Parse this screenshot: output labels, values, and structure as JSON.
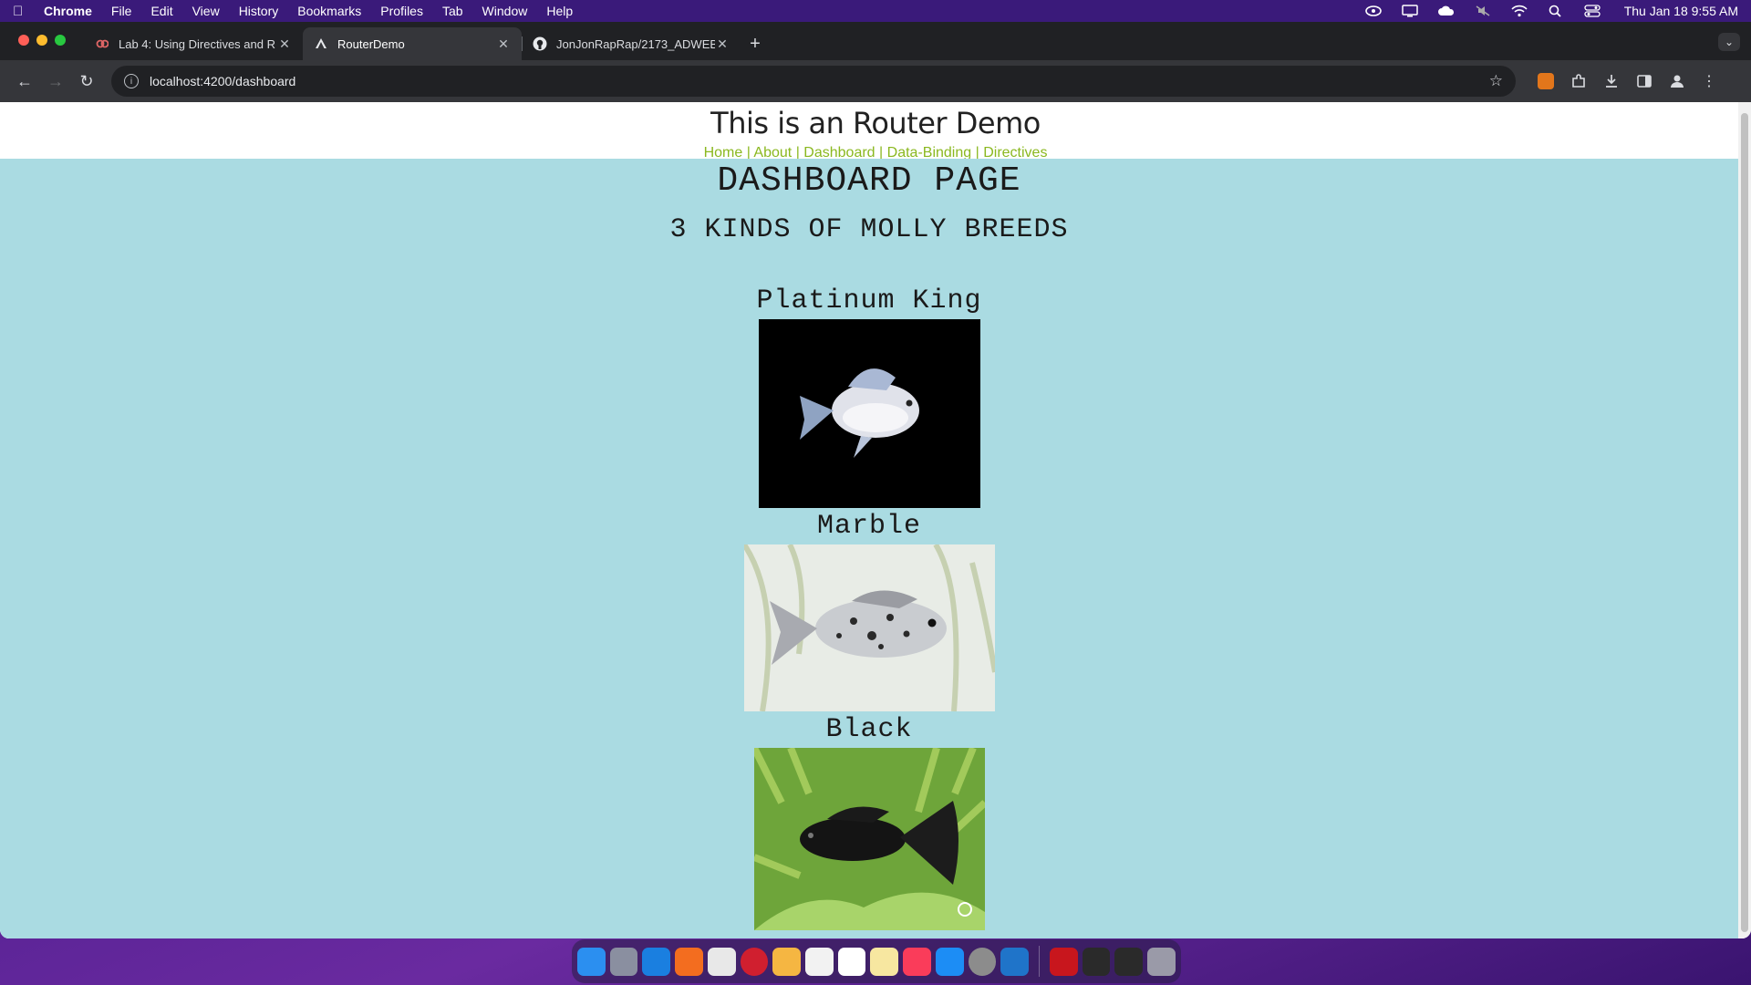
{
  "menubar": {
    "app_name": "Chrome",
    "items": [
      "File",
      "Edit",
      "View",
      "History",
      "Bookmarks",
      "Profiles",
      "Tab",
      "Window",
      "Help"
    ],
    "clock": "Thu Jan 18  9:55 AM"
  },
  "browser": {
    "tabs": [
      {
        "title": "Lab 4: Using Directives and R",
        "favicon": "lab-favicon"
      },
      {
        "title": "RouterDemo",
        "favicon": "angular-favicon"
      },
      {
        "title": "JonJonRapRap/2173_ADWEB",
        "favicon": "github-icon"
      }
    ],
    "active_tab": 1,
    "url": "localhost:4200/dashboard"
  },
  "page": {
    "header_title": "This is an Router Demo",
    "nav_links": [
      "Home",
      "About",
      "Dashboard",
      "Data-Binding",
      "Directives"
    ],
    "nav_separator": "|",
    "dashboard_title": "DASHBOARD PAGE",
    "dashboard_subtitle": "3 KINDS OF MOLLY BREEDS",
    "breeds": [
      {
        "name": "Platinum King",
        "image": "platinum-molly-photo"
      },
      {
        "name": "Marble",
        "image": "marble-molly-photo"
      },
      {
        "name": "Black",
        "image": "black-molly-photo"
      }
    ],
    "colors": {
      "dashboard_bg": "#aadbe2",
      "nav_link": "#8ab81f"
    }
  }
}
